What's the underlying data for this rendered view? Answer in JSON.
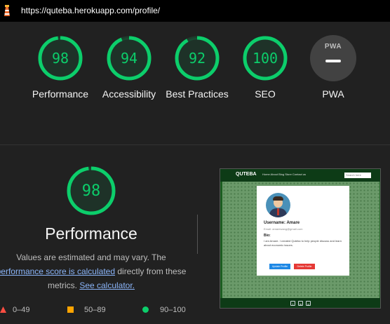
{
  "browser": {
    "url": "https://quteba.herokuapp.com/profile/"
  },
  "colors": {
    "pass": "#0cce6b",
    "average": "#ffa400",
    "fail": "#ff4e42",
    "background": "#212121"
  },
  "scores": [
    {
      "label": "Performance",
      "value": "98",
      "fraction": 0.98
    },
    {
      "label": "Accessibility",
      "value": "94",
      "fraction": 0.94
    },
    {
      "label": "Best Practices",
      "value": "92",
      "fraction": 0.92
    },
    {
      "label": "SEO",
      "value": "100",
      "fraction": 1.0
    }
  ],
  "pwa": {
    "label": "PWA",
    "badge_text": "PWA"
  },
  "detail": {
    "score": "98",
    "fraction": 0.98,
    "title": "Performance",
    "note_line1": "Values are estimated and may vary. The",
    "note_link1": "performance score is calculated",
    "note_line2_rest": " directly from these",
    "note_line3_start": "metrics. ",
    "note_link2": "See calculator."
  },
  "legend": [
    {
      "range": "0–49",
      "icon": "triangle-icon"
    },
    {
      "range": "50–89",
      "icon": "square-icon"
    },
    {
      "range": "90–100",
      "icon": "circle-icon"
    }
  ],
  "screenshot": {
    "logo": "QUTEBA",
    "nav": "Home  About  Blog  Store  Contact us",
    "search_placeholder": "Search here",
    "username": "Username: Amare",
    "email": "Email: amarewang@gmail.com",
    "bio_heading": "Bio:",
    "bio_text": "I am Amare. I created Quteba to help people discuss and learn about economic issues.",
    "update_button": "Update Profile",
    "delete_button": "Delete Profile"
  }
}
